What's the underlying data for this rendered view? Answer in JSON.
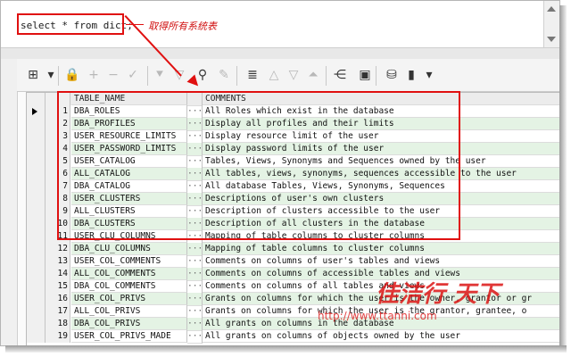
{
  "editor": {
    "sql": "select * from dict;",
    "annotation": "取得所有系统表"
  },
  "toolbar": {
    "buttons": [
      {
        "name": "grid-view-icon",
        "glyph": "⊞",
        "enabled": true
      },
      {
        "name": "dropdown-icon",
        "glyph": "▾",
        "enabled": true
      },
      {
        "name": "lock-icon",
        "glyph": "🔒",
        "enabled": true
      },
      {
        "name": "add-record-icon",
        "glyph": "+",
        "enabled": false
      },
      {
        "name": "delete-record-icon",
        "glyph": "−",
        "enabled": false
      },
      {
        "name": "post-record-icon",
        "glyph": "✓",
        "enabled": false
      },
      {
        "name": "filter-down-icon",
        "glyph": "⯆",
        "enabled": false
      },
      {
        "name": "filter-icon",
        "glyph": "▽",
        "enabled": false
      },
      {
        "name": "find-icon",
        "glyph": "⚲",
        "enabled": true
      },
      {
        "name": "eraser-icon",
        "glyph": "✎",
        "enabled": false
      },
      {
        "name": "stack-icon",
        "glyph": "≣",
        "enabled": true
      },
      {
        "name": "previous-icon",
        "glyph": "△",
        "enabled": false
      },
      {
        "name": "next-icon",
        "glyph": "▽",
        "enabled": false
      },
      {
        "name": "last-icon",
        "glyph": "⏶",
        "enabled": false
      },
      {
        "name": "tree-icon",
        "glyph": "⋲",
        "enabled": true
      },
      {
        "name": "save-icon",
        "glyph": "▣",
        "enabled": true
      },
      {
        "name": "export-icon",
        "glyph": "⛁",
        "enabled": true
      },
      {
        "name": "chart-icon",
        "glyph": "▮",
        "enabled": true
      },
      {
        "name": "dropdown-icon-2",
        "glyph": "▾",
        "enabled": true
      }
    ]
  },
  "grid": {
    "columns": [
      "TABLE_NAME",
      "COMMENTS"
    ],
    "rows": [
      {
        "num": "1",
        "table_name": "DBA_ROLES",
        "comments": "All Roles which exist in the database"
      },
      {
        "num": "2",
        "table_name": "DBA_PROFILES",
        "comments": "Display all profiles and their limits"
      },
      {
        "num": "3",
        "table_name": "USER_RESOURCE_LIMITS",
        "comments": "Display resource limit of the user"
      },
      {
        "num": "4",
        "table_name": "USER_PASSWORD_LIMITS",
        "comments": "Display password limits of the user"
      },
      {
        "num": "5",
        "table_name": "USER_CATALOG",
        "comments": "Tables, Views, Synonyms and Sequences owned by the user"
      },
      {
        "num": "6",
        "table_name": "ALL_CATALOG",
        "comments": "All tables, views, synonyms, sequences accessible to the user"
      },
      {
        "num": "7",
        "table_name": "DBA_CATALOG",
        "comments": "All database Tables, Views, Synonyms, Sequences"
      },
      {
        "num": "8",
        "table_name": "USER_CLUSTERS",
        "comments": "Descriptions of user's own clusters"
      },
      {
        "num": "9",
        "table_name": "ALL_CLUSTERS",
        "comments": "Description of clusters accessible to the user"
      },
      {
        "num": "10",
        "table_name": "DBA_CLUSTERS",
        "comments": "Description of all clusters in the database"
      },
      {
        "num": "11",
        "table_name": "USER_CLU_COLUMNS",
        "comments": "Mapping of table columns to cluster columns"
      },
      {
        "num": "12",
        "table_name": "DBA_CLU_COLUMNS",
        "comments": "Mapping of table columns to cluster columns"
      },
      {
        "num": "13",
        "table_name": "USER_COL_COMMENTS",
        "comments": "Comments on columns of user's tables and views"
      },
      {
        "num": "14",
        "table_name": "ALL_COL_COMMENTS",
        "comments": "Comments on columns of accessible tables and views"
      },
      {
        "num": "15",
        "table_name": "DBA_COL_COMMENTS",
        "comments": "Comments on columns of all tables and views"
      },
      {
        "num": "16",
        "table_name": "USER_COL_PRIVS",
        "comments": "Grants on columns for which the user is the owner, grantor or gr"
      },
      {
        "num": "17",
        "table_name": "ALL_COL_PRIVS",
        "comments": "Grants on columns for which the user is the grantor, grantee, o"
      },
      {
        "num": "18",
        "table_name": "DBA_COL_PRIVS",
        "comments": "All grants on columns in the database"
      },
      {
        "num": "19",
        "table_name": "USER_COL_PRIVS_MADE",
        "comments": "All grants on columns of objects owned by the user"
      }
    ]
  },
  "watermark": {
    "text": "佳洁行 天下",
    "url": "http://www.ttanni.com"
  },
  "colors": {
    "highlight": "#e01010",
    "alt_row": "#e4f3e4"
  }
}
